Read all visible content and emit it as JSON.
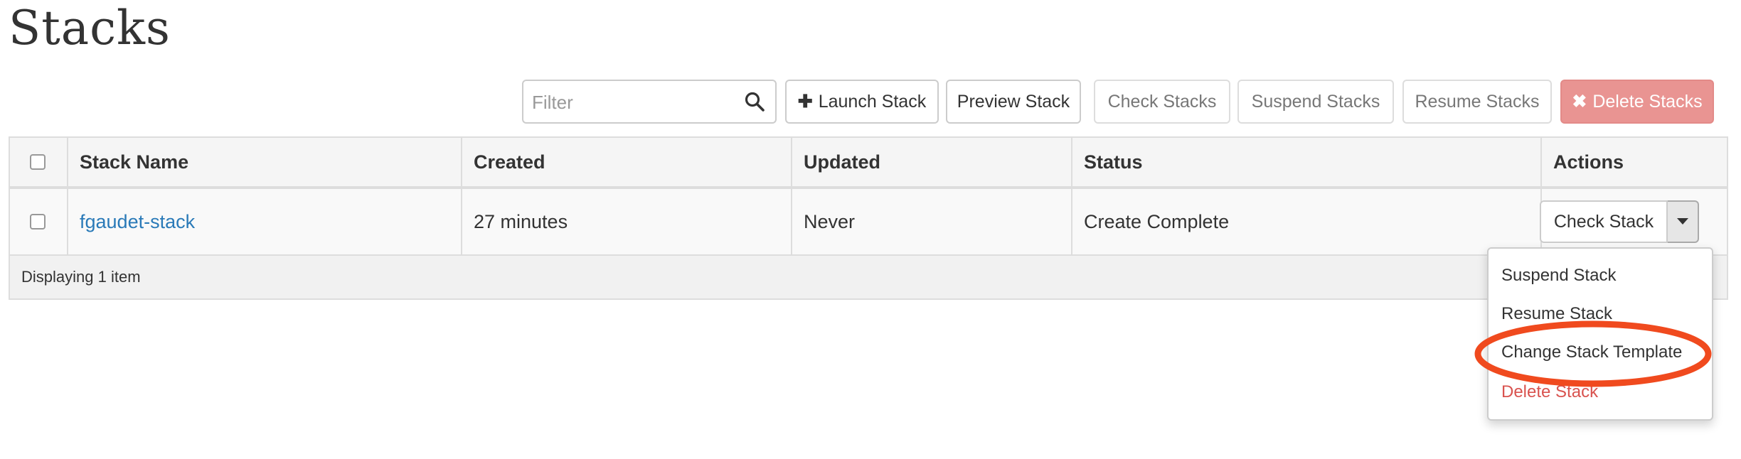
{
  "page": {
    "title": "Stacks"
  },
  "toolbar": {
    "filter_placeholder": "Filter",
    "launch_label": "Launch Stack",
    "preview_label": "Preview Stack",
    "check_label": "Check Stacks",
    "suspend_label": "Suspend Stacks",
    "resume_label": "Resume Stacks",
    "delete_label": "Delete Stacks",
    "icons": {
      "search": "search-icon",
      "launch": "plus-icon",
      "delete": "times-icon"
    }
  },
  "table": {
    "columns": [
      "Stack Name",
      "Created",
      "Updated",
      "Status",
      "Actions"
    ],
    "rows": [
      {
        "name": "fgaudet-stack",
        "created": "27 minutes",
        "updated": "Never",
        "status": "Create Complete",
        "action": "Check Stack"
      }
    ],
    "footer": "Displaying 1 item"
  },
  "dropdown": {
    "items": [
      "Suspend Stack",
      "Resume Stack",
      "Change Stack Template",
      "Delete Stack"
    ]
  },
  "colors": {
    "link": "#2a7ab8",
    "danger": "#d9534f",
    "danger_button": "#e99492",
    "annotation": "#f04a1e"
  }
}
